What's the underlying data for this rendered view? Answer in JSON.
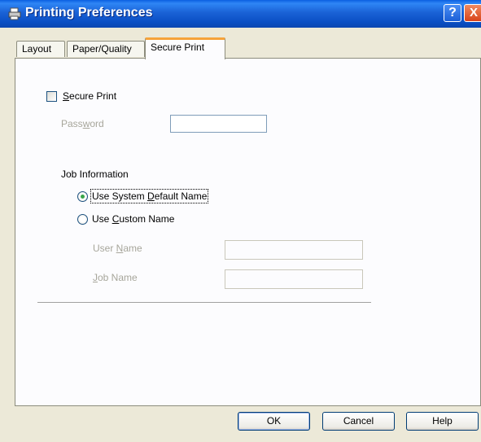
{
  "window": {
    "title": "Printing Preferences",
    "help_glyph": "?",
    "close_glyph": "X"
  },
  "tabs": [
    {
      "label": "Layout",
      "active": false
    },
    {
      "label": "Paper/Quality",
      "active": false
    },
    {
      "label": "Secure Print",
      "active": true
    }
  ],
  "secure_print": {
    "checkbox_label_accel": "S",
    "checkbox_label_rest": "ecure Print",
    "checked": false,
    "password_label_pre": "Pass",
    "password_label_accel": "w",
    "password_label_post": "ord",
    "password_value": ""
  },
  "job_info": {
    "heading": "Job Information",
    "system_default_pre": "Use System ",
    "system_default_accel": "D",
    "system_default_post": "efault Name",
    "system_default_selected": true,
    "custom_pre": "Use ",
    "custom_accel": "C",
    "custom_post": "ustom Name",
    "custom_selected": false,
    "user_name_pre": "User ",
    "user_name_accel": "N",
    "user_name_post": "ame",
    "job_name_accel": "J",
    "job_name_post": "ob Name",
    "user_name_value": "",
    "job_name_value": ""
  },
  "buttons": {
    "ok": "OK",
    "cancel": "Cancel",
    "help": "Help"
  },
  "colors": {
    "titlebar": "#0a4fc4",
    "active_tab_accent": "#f6a33a",
    "dialog_bg": "#ece9d8",
    "radio_dot": "#3aa54a"
  }
}
